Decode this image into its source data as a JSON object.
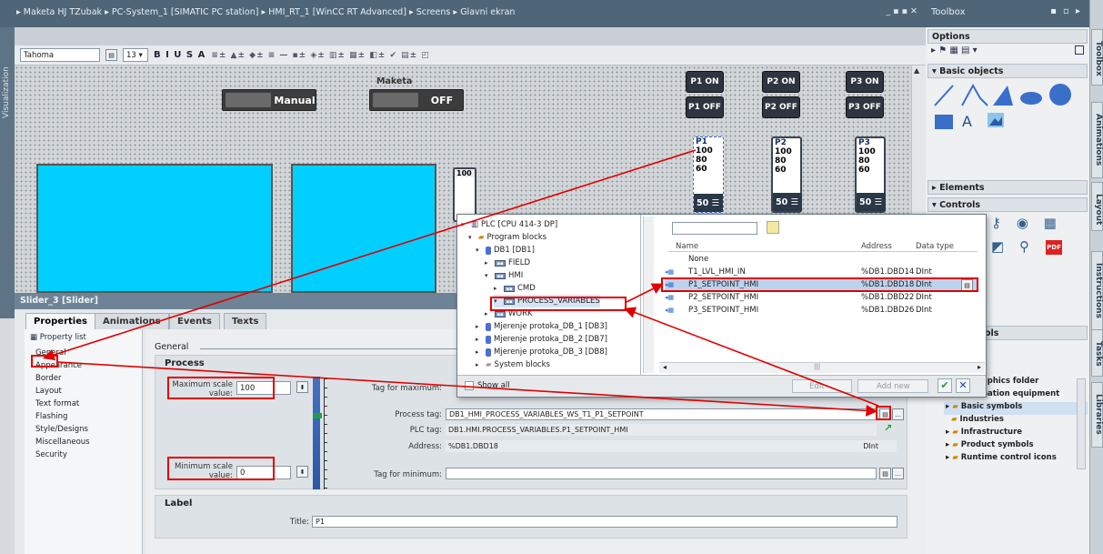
{
  "breadcrumb": [
    "Maketa HJ TZubak",
    "PC-System_1 [SIMATIC PC station]",
    "HMI_RT_1 [WinCC RT Advanced]",
    "Screens",
    "Glavni ekran"
  ],
  "side_tab": "Visualization",
  "font_toolbar": {
    "font": "Tahoma",
    "size": "13",
    "format_glyphs": "B I U S A"
  },
  "canvas": {
    "mode_label": "Maketa",
    "manual_button": "Manual",
    "off_button": "OFF",
    "pump_buttons": [
      {
        "on": "P1 ON",
        "off": "P1 OFF"
      },
      {
        "on": "P2 ON",
        "off": "P2 OFF"
      },
      {
        "on": "P3 ON",
        "off": "P3 OFF"
      }
    ],
    "sliders": [
      {
        "label": "P1",
        "max": "100",
        "mid": "80",
        "low": "60",
        "value": "50"
      },
      {
        "label": "P2",
        "max": "100",
        "mid": "80",
        "low": "60",
        "value": "50"
      },
      {
        "label": "P3",
        "max": "100",
        "mid": "80",
        "low": "60",
        "value": "50"
      }
    ],
    "screen_slider_max": "100"
  },
  "inspector": {
    "title": "Slider_3 [Slider]",
    "tabs": [
      "Properties",
      "Animations",
      "Events",
      "Texts"
    ],
    "property_list_label": "Property list",
    "property_items": [
      "General",
      "Appearance",
      "Border",
      "Layout",
      "Text format",
      "Flashing",
      "Style/Designs",
      "Miscellaneous",
      "Security"
    ],
    "general_header": "General",
    "process_section": "Process",
    "max_scale_label": "Maximum scale value:",
    "max_scale_value": "100",
    "min_scale_label": "Minimum scale value:",
    "min_scale_value": "0",
    "tag_for_maximum_label": "Tag for maximum:",
    "process_tag_label": "Process tag:",
    "process_tag_value": "DB1_HMI_PROCESS_VARIABLES_WS_T1_P1_SETPOINT",
    "plc_tag_label": "PLC tag:",
    "plc_tag_value": "DB1.HMI.PROCESS_VARIABLES.P1_SETPOINT_HMI",
    "address_label": "Address:",
    "address_value": "%DB1.DBD18",
    "data_type_value": "DInt",
    "tag_for_minimum_label": "Tag for minimum:",
    "label_section": "Label",
    "title_label": "Title:",
    "title_value": "P1"
  },
  "popup": {
    "tree": [
      {
        "text": "PLC [CPU 414-3 DP]",
        "level": 0
      },
      {
        "text": "Program blocks",
        "level": 1
      },
      {
        "text": "DB1 [DB1]",
        "level": 2
      },
      {
        "text": "FIELD",
        "level": 3
      },
      {
        "text": "HMI",
        "level": 3
      },
      {
        "text": "CMD",
        "level": 4
      },
      {
        "text": "PROCESS_VARIABLES",
        "level": 4
      },
      {
        "text": "WORK",
        "level": 3
      },
      {
        "text": "Mjerenje protoka_DB_1 [DB3]",
        "level": 2
      },
      {
        "text": "Mjerenje protoka_DB_2 [DB7]",
        "level": 2
      },
      {
        "text": "Mjerenje protoka_DB_3 [DB8]",
        "level": 2
      },
      {
        "text": "System blocks",
        "level": 2
      }
    ],
    "columns": {
      "name": "Name",
      "address": "Address",
      "type": "Data type"
    },
    "rows": [
      {
        "name": "None",
        "address": "",
        "type": ""
      },
      {
        "name": "T1_LVL_HMI_IN",
        "address": "%DB1.DBD14",
        "type": "DInt"
      },
      {
        "name": "P1_SETPOINT_HMI",
        "address": "%DB1.DBD18",
        "type": "DInt"
      },
      {
        "name": "P2_SETPOINT_HMI",
        "address": "%DB1.DBD22",
        "type": "DInt"
      },
      {
        "name": "P3_SETPOINT_HMI",
        "address": "%DB1.DBD26",
        "type": "DInt"
      }
    ],
    "show_all": "Show all",
    "edit_button": "Edit",
    "add_new_button": "Add new"
  },
  "toolbox": {
    "title": "Toolbox",
    "options": "Options",
    "basic_objects": "Basic objects",
    "text_tool": "A",
    "elements": "Elements",
    "controls": "Controls",
    "graphics_partial": "ols",
    "library_items": [
      "aphics folder",
      "nation equipment",
      "Basic symbols",
      "Industries",
      "Infrastructure",
      "Product symbols",
      "Runtime control icons"
    ]
  },
  "right_tabs": [
    "Toolbox",
    "Animations",
    "Layout",
    "Instructions",
    "Tasks",
    "Libraries"
  ]
}
